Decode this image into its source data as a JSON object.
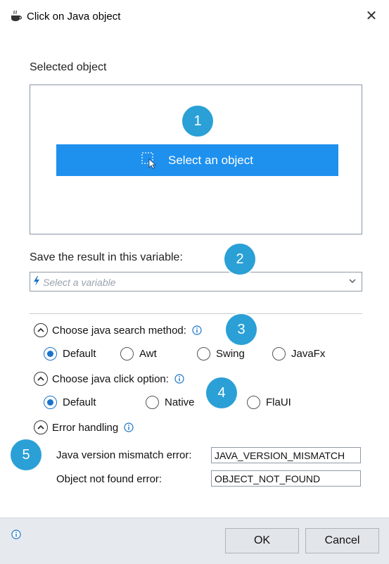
{
  "window": {
    "title": "Click on Java object",
    "close_glyph": "✕"
  },
  "selected_object": {
    "label": "Selected object",
    "button_label": "Select an object"
  },
  "variable": {
    "label": "Save the result in this variable:",
    "placeholder": "Select a variable"
  },
  "search_method": {
    "label": "Choose java search method:",
    "options": [
      "Default",
      "Awt",
      "Swing",
      "JavaFx"
    ],
    "selected": "Default"
  },
  "click_option": {
    "label": "Choose java click option:",
    "options": [
      "Default",
      "Native",
      "FlaUI"
    ],
    "selected": "Default"
  },
  "error_handling": {
    "label": "Error handling",
    "fields": [
      {
        "label": "Java version mismatch error:",
        "value": "JAVA_VERSION_MISMATCH"
      },
      {
        "label": "Object not found error:",
        "value": "OBJECT_NOT_FOUND"
      }
    ]
  },
  "badges": [
    "1",
    "2",
    "3",
    "4",
    "5"
  ],
  "footer": {
    "ok_label": "OK",
    "cancel_label": "Cancel"
  },
  "colors": {
    "accent": "#1e90ee",
    "badge": "#2aa0d6",
    "info": "#1a73c9",
    "footer_bg": "#e6e9ee"
  },
  "icons": {
    "title": "java-coffee-cup-icon",
    "select": "dashed-selection-cursor-icon",
    "variable": "lightning-bolt-icon",
    "info": "info-circle-icon",
    "expander": "chevron-up-icon"
  }
}
